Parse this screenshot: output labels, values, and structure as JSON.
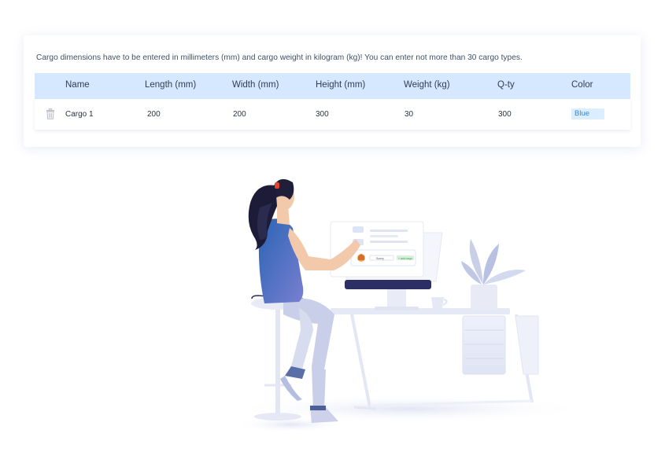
{
  "notice": "Cargo dimensions have to be entered in millimeters (mm) and cargo weight in kilogram (kg)! You can enter not more than 30 cargo types.",
  "table": {
    "headers": [
      "Name",
      "Length (mm)",
      "Width (mm)",
      "Height (mm)",
      "Weight (kg)",
      "Q-ty",
      "Color"
    ],
    "rows": [
      {
        "name": "Cargo 1",
        "length": "200",
        "width": "200",
        "height": "300",
        "weight": "30",
        "qty": "300",
        "color": "Blue"
      }
    ]
  },
  "colors": {
    "header_bg": "#d6e8ff",
    "color_field_bg": "#dbeeff",
    "color_field_text": "#2d8ae6",
    "accent_dark": "#2c2f63"
  },
  "icons": {
    "delete": "trash-icon"
  }
}
